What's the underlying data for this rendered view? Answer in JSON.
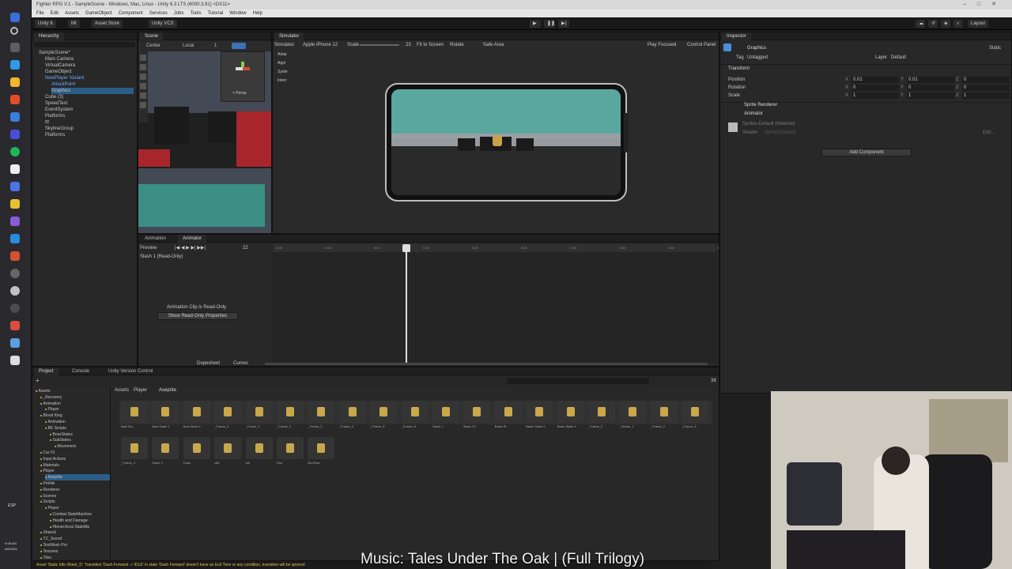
{
  "window": {
    "title": "Fighter RPG V.1 - SampleScene - Windows, Mac, Linux - Unity 6.3 LTS (6000.3.81) <DX11>",
    "controls": [
      "–",
      "□",
      "✕"
    ]
  },
  "menu": [
    "File",
    "Edit",
    "Assets",
    "GameObject",
    "Component",
    "Services",
    "Jobs",
    "Tools",
    "Tutorial",
    "Window",
    "Help"
  ],
  "toolbar": {
    "account": "Unity 6",
    "user": "MI",
    "asset_store": "Asset Store",
    "vcs": "Unity VCS",
    "layout": "Layout"
  },
  "hierarchy": {
    "tab": "Hierarchy",
    "items": [
      {
        "label": "SampleScene*",
        "depth": 0,
        "blue": false,
        "selected": false
      },
      {
        "label": "Main Camera",
        "depth": 1,
        "blue": false,
        "selected": false
      },
      {
        "label": "VirtualCamera",
        "depth": 1,
        "blue": false,
        "selected": false
      },
      {
        "label": "GameObject",
        "depth": 1,
        "blue": false,
        "selected": false
      },
      {
        "label": "NewPlayer Variant",
        "depth": 1,
        "blue": true,
        "selected": false
      },
      {
        "label": "AttackPoint",
        "depth": 2,
        "blue": true,
        "selected": false
      },
      {
        "label": "Graphics",
        "depth": 2,
        "blue": false,
        "selected": true
      },
      {
        "label": "Cube (3)",
        "depth": 1,
        "blue": false,
        "selected": false
      },
      {
        "label": "SpeedText",
        "depth": 1,
        "blue": false,
        "selected": false
      },
      {
        "label": "EventSystem",
        "depth": 1,
        "blue": false,
        "selected": false
      },
      {
        "label": "Platforms",
        "depth": 1,
        "blue": false,
        "selected": false
      },
      {
        "label": "ttt",
        "depth": 1,
        "blue": false,
        "selected": false
      },
      {
        "label": "SkylineGroup",
        "depth": 1,
        "blue": false,
        "selected": false
      },
      {
        "label": "Platforms",
        "depth": 1,
        "blue": false,
        "selected": false
      }
    ]
  },
  "scene": {
    "tab": "Scene",
    "pivot": "Center",
    "space": "Local",
    "persp": "< Persp",
    "number": "1"
  },
  "simulator": {
    "tab": "Simulator",
    "mode": "Simulator",
    "device": "Apple iPhone 12",
    "scale_label": "Scale",
    "scale_value": "23",
    "fit": "Fit to Screen",
    "rotate": "Rotate",
    "safe_area": "Safe Area",
    "play_focused": "Play Focused",
    "control_panel": "Control Panel",
    "side_items": [
      "Adap",
      "Appl",
      "Syste",
      "Interr"
    ]
  },
  "inspector": {
    "tab": "Inspector",
    "object_name": "Graphics",
    "static": "Static",
    "tag_label": "Tag",
    "tag_value": "Untagged",
    "layer_label": "Layer",
    "layer_value": "Default",
    "transform": {
      "title": "Transform",
      "rows": [
        {
          "label": "Position",
          "x": "0.01",
          "y": "0.01",
          "z": "0"
        },
        {
          "label": "Rotation",
          "x": "0",
          "y": "0",
          "z": "0"
        },
        {
          "label": "Scale",
          "x": "1",
          "y": "1",
          "z": "1"
        }
      ]
    },
    "sprite_renderer": "Sprite Renderer",
    "animator": "Animator",
    "material": "Sprites-Default (Material)",
    "shader_label": "Shader",
    "shader_value": "Sprites/Default",
    "edit": "Edit...",
    "add_component": "Add Component"
  },
  "animation": {
    "tabs": [
      "Animation",
      "Animator"
    ],
    "preview": "Preview",
    "frame": "22",
    "clip": "Slash 1 (Read-Only)",
    "readonly_msg": "Animation Clip is Read-Only",
    "show_props": "Show Read-Only Properties",
    "dopesheet": "Dopesheet",
    "curves": "Curves",
    "ticks": [
      "0:00",
      "0:05",
      "0:10",
      "0:15",
      "0:20",
      "0:25",
      "0:30",
      "0:35",
      "0:40",
      "0:45",
      "0:50",
      "0:55"
    ]
  },
  "project": {
    "tabs": [
      "Project",
      "Console",
      "Unity Version Control"
    ],
    "breadcrumb": [
      "Assets",
      "Player",
      "Aseprite"
    ],
    "count": "38",
    "tree": [
      {
        "label": "Assets",
        "depth": 0,
        "selected": false
      },
      {
        "label": "_Recovery",
        "depth": 1,
        "selected": false
      },
      {
        "label": "Animation",
        "depth": 1,
        "selected": false
      },
      {
        "label": "Player",
        "depth": 2,
        "selected": false
      },
      {
        "label": "Blood King",
        "depth": 1,
        "selected": false
      },
      {
        "label": "Animation",
        "depth": 2,
        "selected": false
      },
      {
        "label": "BK Scripts",
        "depth": 2,
        "selected": false
      },
      {
        "label": "BossStates",
        "depth": 3,
        "selected": false
      },
      {
        "label": "SubStates",
        "depth": 3,
        "selected": false
      },
      {
        "label": "Movement",
        "depth": 4,
        "selected": false
      },
      {
        "label": "Car 01",
        "depth": 1,
        "selected": false
      },
      {
        "label": "Input Actions",
        "depth": 1,
        "selected": false
      },
      {
        "label": "Materials",
        "depth": 1,
        "selected": false
      },
      {
        "label": "Player",
        "depth": 1,
        "selected": false
      },
      {
        "label": "Aseprite",
        "depth": 2,
        "selected": true
      },
      {
        "label": "Prefab",
        "depth": 1,
        "selected": false
      },
      {
        "label": "Renderer",
        "depth": 1,
        "selected": false
      },
      {
        "label": "Scenes",
        "depth": 1,
        "selected": false
      },
      {
        "label": "Scripts",
        "depth": 1,
        "selected": false
      },
      {
        "label": "Player",
        "depth": 2,
        "selected": false
      },
      {
        "label": "Combat StateMachine",
        "depth": 3,
        "selected": false
      },
      {
        "label": "Health and Damage",
        "depth": 3,
        "selected": false
      },
      {
        "label": "Hierarchical StateMa",
        "depth": 3,
        "selected": false
      },
      {
        "label": "Shared",
        "depth": 1,
        "selected": false
      },
      {
        "label": "TC_Sword",
        "depth": 1,
        "selected": false
      },
      {
        "label": "TextMesh Pro",
        "depth": 1,
        "selected": false
      },
      {
        "label": "Textures",
        "depth": 1,
        "selected": false
      },
      {
        "label": "Tiles",
        "depth": 1,
        "selected": false
      }
    ],
    "assets_row1": [
      "Basi Sla...",
      "Basi Slash 1",
      "Basi Slash 1",
      "_Frame_0",
      "_Frame_1",
      "_Frame_2",
      "_Frame_3",
      "_Frame_4",
      "_Frame_5",
      "_Frame_6",
      "Slash 1",
      "Basic Sl...",
      "Basic Sl...",
      "Basic Slash 2",
      "Basic Slash 2",
      "_Frame_0",
      "_Frame_1",
      "_Frame_2",
      "_Frame_3"
    ],
    "assets_row2": [
      "_Frame_4",
      "Slash 2",
      "Dash",
      "Idle",
      "roll",
      "Run",
      "RunFast"
    ]
  },
  "status_message": "Asset 'Static Idle-Sheet_0': Transition 'Dash Forward -> IDLE' in state 'Dash Forward' doesn't have an Exit Time or any condition, transition will be ignored",
  "caption": "Music: Tales Under The Oak | (Full Trilogy)",
  "clock": {
    "time": "9:08 AM",
    "date": "4/6/2026",
    "lang": "ESP"
  },
  "colors": {
    "selection": "#2c5d87",
    "prefab_blue": "#6fa7ff",
    "teal_ground": "#3b8f85",
    "warning": "#e1c34c"
  }
}
